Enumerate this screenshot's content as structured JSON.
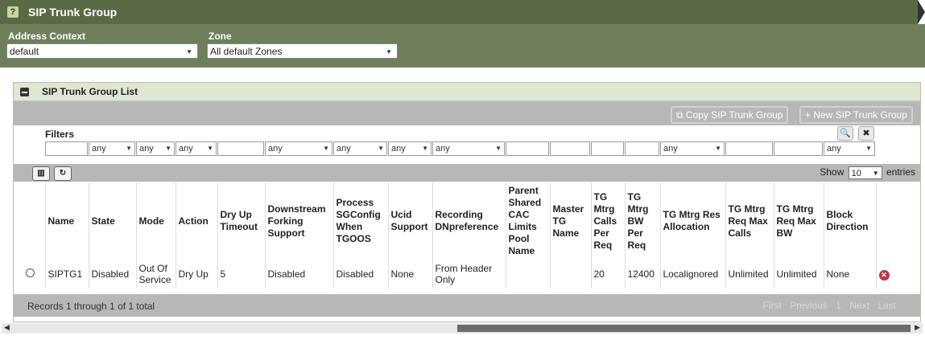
{
  "page": {
    "title": "SIP Trunk Group",
    "help_glyph": "?"
  },
  "filters_top": {
    "address_context_label": "Address Context",
    "address_context_value": "default",
    "zone_label": "Zone",
    "zone_value": "All default Zones"
  },
  "panel": {
    "title": "SIP Trunk Group List",
    "copy_label": "Copy SIP Trunk Group",
    "new_label": "New SIP Trunk Group",
    "filters_label": "Filters",
    "filter_any": "any",
    "show_label": "Show",
    "show_value": "10",
    "entries_label": "entries"
  },
  "table": {
    "headers": [
      "Name",
      "State",
      "Mode",
      "Action",
      "Dry Up Timeout",
      "Downstream Forking Support",
      "Process SGConfig When TGOOS",
      "Ucid Support",
      "Recording DNpreference",
      "Parent Shared CAC Limits Pool Name",
      "Master TG Name",
      "TG Mtrg Calls Per Req",
      "TG Mtrg BW Per Req",
      "TG Mtrg Res Allocation",
      "TG Mtrg Req Max Calls",
      "TG Mtrg Req Max BW",
      "Block Direction"
    ],
    "rows": [
      [
        "SIPTG1",
        "Disabled",
        "Out Of Service",
        "Dry Up",
        "5",
        "Disabled",
        "Disabled",
        "None",
        "From Header Only",
        "",
        "",
        "20",
        "12400",
        "Localignored",
        "Unlimited",
        "Unlimited",
        "None"
      ]
    ]
  },
  "footer": {
    "records": "Records 1 through 1 of 1 total",
    "first": "First",
    "previous": "Previous",
    "page": "1",
    "next": "Next",
    "last": "Last"
  },
  "colors": {
    "titlebar": "#5a6a46",
    "filterbar": "#6f7f5c",
    "toolbar": "#b7b7b7",
    "delete": "#b9374a"
  }
}
